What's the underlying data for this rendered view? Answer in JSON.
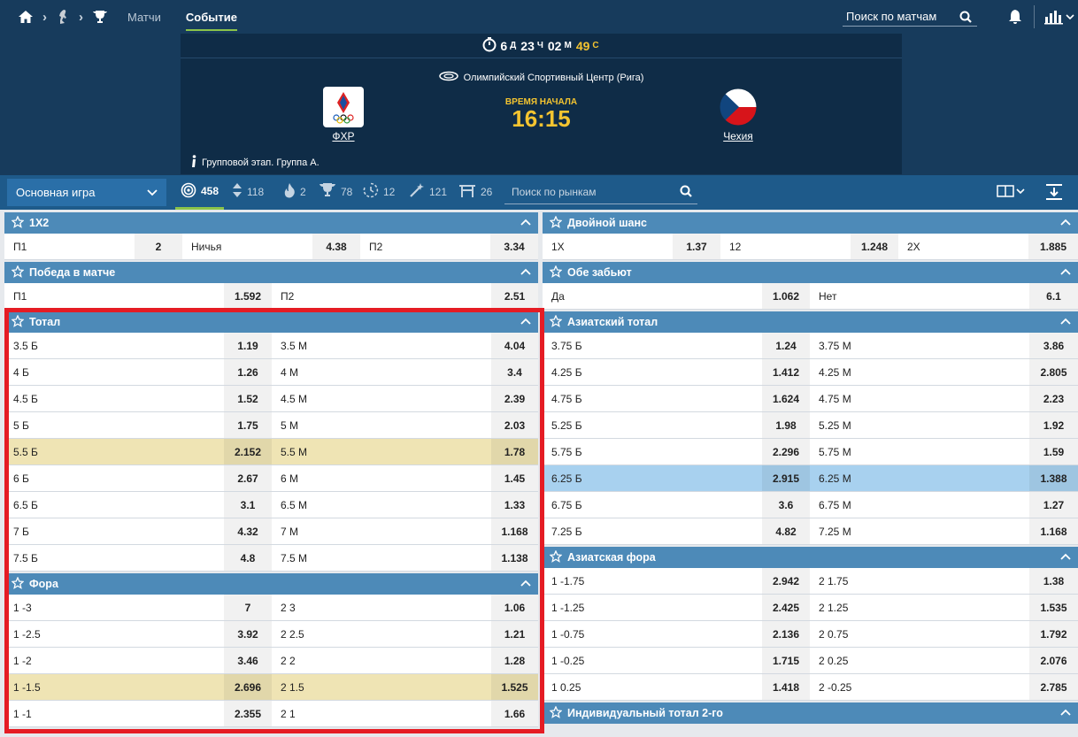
{
  "header": {
    "nav": {
      "matches": "Матчи",
      "event": "Событие"
    },
    "search_placeholder": "Поиск по матчам"
  },
  "event": {
    "timer": {
      "days": "6",
      "d_unit": "Д",
      "hours": "23",
      "h_unit": "Ч",
      "minutes": "02",
      "m_unit": "М",
      "seconds": "49",
      "s_unit": "С"
    },
    "venue": "Олимпийский Спортивный Центр (Рига)",
    "team1": "ФХР",
    "team2": "Чехия",
    "start_label": "ВРЕМЯ НАЧАЛА",
    "start_time": "16:15",
    "stage": "Групповой этап. Группа А."
  },
  "toolbar": {
    "game_select": "Основная игра",
    "tabs": [
      {
        "icon": "target-icon",
        "count": "458"
      },
      {
        "icon": "updown-icon",
        "count": "118"
      },
      {
        "icon": "fire-icon",
        "count": "2"
      },
      {
        "icon": "trophy-icon",
        "count": "78"
      },
      {
        "icon": "clock-icon",
        "count": "12"
      },
      {
        "icon": "wand-icon",
        "count": "121"
      },
      {
        "icon": "gate-icon",
        "count": "26"
      }
    ],
    "market_search_placeholder": "Поиск по рынкам"
  },
  "colors": {
    "accent": "#8bc34a",
    "header_bg": "#173b5c",
    "market_head": "#4d8ab8",
    "highlight": "#efe4b4",
    "selected": "#a8d1ef",
    "outline": "#e51c24",
    "timer_accent": "#f4c430"
  },
  "left": {
    "m1x2": {
      "title": "1X2",
      "rows": [
        [
          "П1",
          "2",
          "Ничья",
          "4.38",
          "П2",
          "3.34"
        ]
      ]
    },
    "win": {
      "title": "Победа в матче",
      "rows": [
        [
          "П1",
          "1.592",
          "П2",
          "2.51"
        ]
      ]
    },
    "total": {
      "title": "Тотал",
      "rows": [
        [
          "3.5 Б",
          "1.19",
          "3.5 М",
          "4.04"
        ],
        [
          "4 Б",
          "1.26",
          "4 М",
          "3.4"
        ],
        [
          "4.5 Б",
          "1.52",
          "4.5 М",
          "2.39"
        ],
        [
          "5 Б",
          "1.75",
          "5 М",
          "2.03"
        ],
        [
          "5.5 Б",
          "2.152",
          "5.5 М",
          "1.78"
        ],
        [
          "6 Б",
          "2.67",
          "6 М",
          "1.45"
        ],
        [
          "6.5 Б",
          "3.1",
          "6.5 М",
          "1.33"
        ],
        [
          "7 Б",
          "4.32",
          "7 М",
          "1.168"
        ],
        [
          "7.5 Б",
          "4.8",
          "7.5 М",
          "1.138"
        ]
      ]
    },
    "handicap": {
      "title": "Фора",
      "rows": [
        [
          "1 -3",
          "7",
          "2 3",
          "1.06"
        ],
        [
          "1 -2.5",
          "3.92",
          "2 2.5",
          "1.21"
        ],
        [
          "1 -2",
          "3.46",
          "2 2",
          "1.28"
        ],
        [
          "1 -1.5",
          "2.696",
          "2 1.5",
          "1.525"
        ],
        [
          "1 -1",
          "2.355",
          "2 1",
          "1.66"
        ]
      ]
    }
  },
  "right": {
    "double": {
      "title": "Двойной шанс",
      "rows": [
        [
          "1X",
          "1.37",
          "12",
          "1.248",
          "2X",
          "1.885"
        ]
      ]
    },
    "btts": {
      "title": "Обе забьют",
      "rows": [
        [
          "Да",
          "1.062",
          "Нет",
          "6.1"
        ]
      ]
    },
    "asian_total": {
      "title": "Азиатский тотал",
      "rows": [
        [
          "3.75 Б",
          "1.24",
          "3.75 М",
          "3.86"
        ],
        [
          "4.25 Б",
          "1.412",
          "4.25 М",
          "2.805"
        ],
        [
          "4.75 Б",
          "1.624",
          "4.75 М",
          "2.23"
        ],
        [
          "5.25 Б",
          "1.98",
          "5.25 М",
          "1.92"
        ],
        [
          "5.75 Б",
          "2.296",
          "5.75 М",
          "1.59"
        ],
        [
          "6.25 Б",
          "2.915",
          "6.25 М",
          "1.388"
        ],
        [
          "6.75 Б",
          "3.6",
          "6.75 М",
          "1.27"
        ],
        [
          "7.25 Б",
          "4.82",
          "7.25 М",
          "1.168"
        ]
      ]
    },
    "asian_handicap": {
      "title": "Азиатская фора",
      "rows": [
        [
          "1 -1.75",
          "2.942",
          "2 1.75",
          "1.38"
        ],
        [
          "1 -1.25",
          "2.425",
          "2 1.25",
          "1.535"
        ],
        [
          "1 -0.75",
          "2.136",
          "2 0.75",
          "1.792"
        ],
        [
          "1 -0.25",
          "1.715",
          "2 0.25",
          "2.076"
        ],
        [
          "1 0.25",
          "1.418",
          "2 -0.25",
          "2.785"
        ]
      ]
    },
    "ind_total": {
      "title": "Индивидуальный тотал 2-го"
    }
  }
}
